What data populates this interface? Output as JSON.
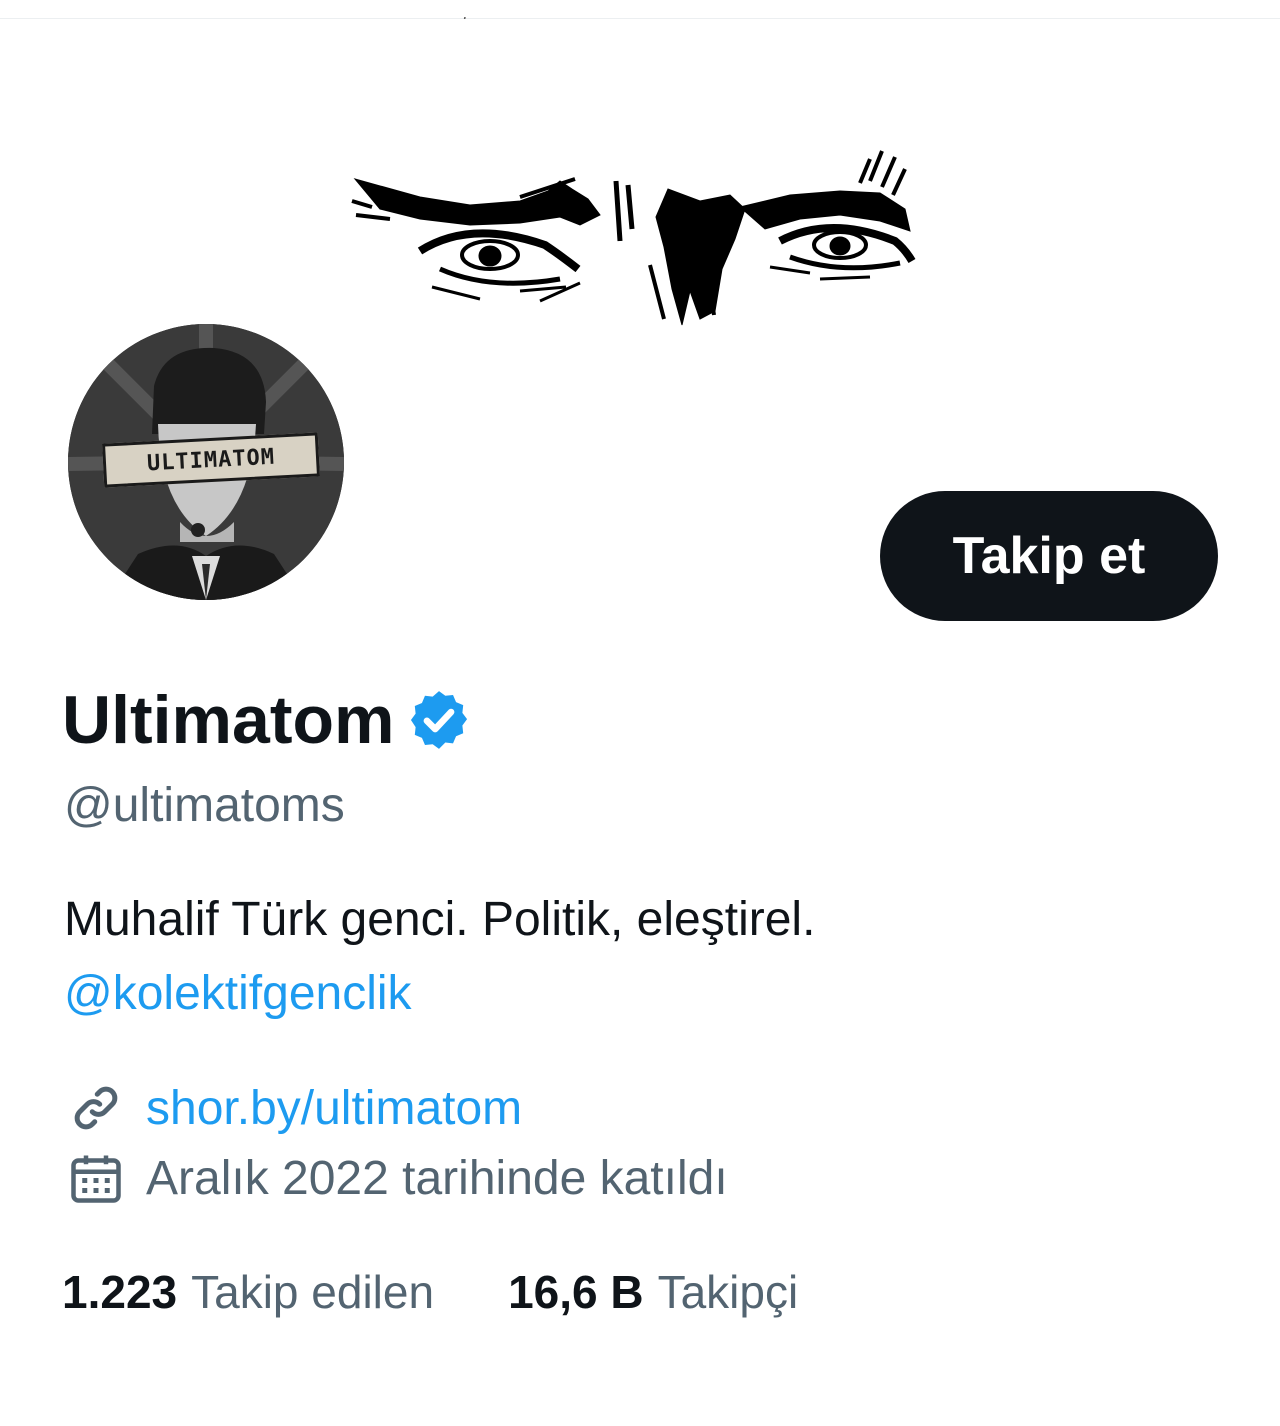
{
  "profile": {
    "display_name": "Ultimatom",
    "handle": "@ultimatoms",
    "verified": true,
    "follow_label": "Takip et",
    "avatar_text": "ULTIMATOM"
  },
  "bio": {
    "text": "Muhalif Türk genci. Politik, eleştirel.",
    "mention": "@kolektifgenclik"
  },
  "meta": {
    "link": "shor.by/ultimatom",
    "joined": "Aralık 2022 tarihinde katıldı",
    "link_icon": "link-icon",
    "calendar_icon": "calendar-icon"
  },
  "stats": {
    "following_count": "1.223",
    "following_label": "Takip edilen",
    "followers_count": "16,6 B",
    "followers_label": "Takipçi"
  },
  "colors": {
    "accent": "#1d9bf0",
    "text": "#0f1419",
    "secondary": "#536471",
    "button_bg": "#0f1419"
  }
}
